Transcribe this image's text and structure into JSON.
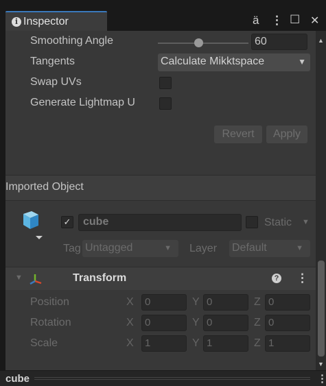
{
  "window": {
    "tab_title": "Inspector",
    "info_glyph": "i",
    "lock_glyph": "ä",
    "menu_glyph": "⋮",
    "maximize_glyph": "☐",
    "close_glyph": "✕"
  },
  "settings": {
    "smoothing_angle": {
      "label": "Smoothing Angle",
      "value": "60",
      "slider_fraction": 0.45
    },
    "tangents": {
      "label": "Tangents",
      "value": "Calculate Mikktspace"
    },
    "swap_uvs": {
      "label": "Swap UVs",
      "checked": false
    },
    "generate_lightmap": {
      "label": "Generate Lightmap U",
      "checked": false
    },
    "revert_label": "Revert",
    "apply_label": "Apply"
  },
  "imported_object": {
    "header": "Imported Object",
    "name": "cube",
    "active_check": "✓",
    "static_label": "Static",
    "tag_label": "Tag",
    "tag_value": "Untagged",
    "layer_label": "Layer",
    "layer_value": "Default"
  },
  "transform": {
    "title": "Transform",
    "help_glyph": "?",
    "menu_glyph": "⋮",
    "rows": [
      {
        "label": "Position",
        "x": "0",
        "y": "0",
        "z": "0"
      },
      {
        "label": "Rotation",
        "x": "0",
        "y": "0",
        "z": "0"
      },
      {
        "label": "Scale",
        "x": "1",
        "y": "1",
        "z": "1"
      }
    ],
    "axis_x": "X",
    "axis_y": "Y",
    "axis_z": "Z"
  },
  "status": {
    "object_name": "cube",
    "menu_glyph": "⋮"
  },
  "colors": {
    "accent": "#3a79bb",
    "panel": "#383838",
    "field": "#2a2a2a"
  }
}
